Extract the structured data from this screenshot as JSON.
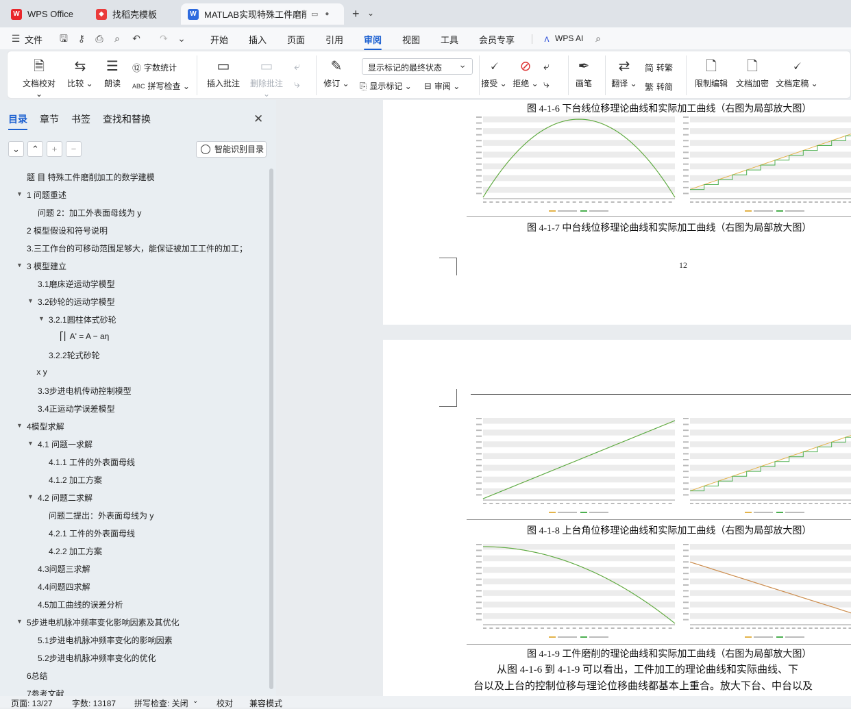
{
  "tabs": [
    {
      "label": "WPS Office",
      "icon": "wps-logo-icon"
    },
    {
      "label": "找稻壳模板",
      "icon": "docer-icon"
    },
    {
      "label": "MATLAB实现特殊工件磨削加",
      "icon": "word-doc-icon"
    }
  ],
  "menu": {
    "file": "文件",
    "items": [
      "开始",
      "插入",
      "页面",
      "引用",
      "审阅",
      "视图",
      "工具",
      "会员专享"
    ],
    "active": "审阅",
    "wps_ai": "WPS AI"
  },
  "ribbon": {
    "proofread": "文档校对",
    "compare": "比较",
    "read_aloud": "朗读",
    "word_count": "字数统计",
    "spell_check": "拼写检查",
    "insert_comment": "插入批注",
    "delete_comment": "删除批注",
    "revise": "修订",
    "markup_state": "显示标记的最终状态",
    "show_markup": "显示标记",
    "review": "审阅",
    "accept": "接受",
    "reject": "拒绝",
    "pen": "画笔",
    "translate": "翻译",
    "to_traditional": "转繁",
    "to_simplified": "转简",
    "restrict_edit": "限制编辑",
    "encrypt": "文档加密",
    "finalize": "文档定稿"
  },
  "sidebar": {
    "tabs": [
      "目录",
      "章节",
      "书签",
      "查找和替换"
    ],
    "smart_toc": "智能识别目录",
    "toc": [
      {
        "text": "题 目  特殊工件磨削加工的数学建模",
        "level": 0,
        "arrow": ""
      },
      {
        "text": "1 问题重述",
        "level": 0,
        "arrow": "▼"
      },
      {
        "text": "问题 2：加工外表面母线为 y",
        "level": 1,
        "arrow": ""
      },
      {
        "text": "2 模型假设和符号说明",
        "level": 0,
        "arrow": ""
      },
      {
        "text": "3.三工作台的可移动范围足够大，能保证被加工工件的加工；",
        "level": 0,
        "arrow": ""
      },
      {
        "text": "3 模型建立",
        "level": 0,
        "arrow": "▼"
      },
      {
        "text": "3.1磨床逆运动学模型",
        "level": 1,
        "arrow": ""
      },
      {
        "text": "3.2砂轮的运动学模型",
        "level": 1,
        "arrow": "▼"
      },
      {
        "text": "3.2.1圆柱体式砂轮",
        "level": 2,
        "arrow": "▼"
      },
      {
        "text": "⎡⎢ A' = A  − aη",
        "level": 3,
        "arrow": ""
      },
      {
        "text": "3.2.2轮式砂轮",
        "level": 2,
        "arrow": ""
      },
      {
        "text": "x y",
        "level": 0.9,
        "arrow": ""
      },
      {
        "text": "3.3步进电机传动控制模型",
        "level": 1,
        "arrow": ""
      },
      {
        "text": "3.4正运动学误差模型",
        "level": 1,
        "arrow": ""
      },
      {
        "text": "4模型求解",
        "level": 0,
        "arrow": "▼"
      },
      {
        "text": "4.1 问题一求解",
        "level": 1,
        "arrow": "▼"
      },
      {
        "text": "4.1.1 工件的外表面母线",
        "level": 2,
        "arrow": ""
      },
      {
        "text": "4.1.2 加工方案",
        "level": 2,
        "arrow": ""
      },
      {
        "text": "4.2 问题二求解",
        "level": 1,
        "arrow": "▼"
      },
      {
        "text": "问题二提出：外表面母线为 y",
        "level": 2,
        "arrow": ""
      },
      {
        "text": "4.2.1 工件的外表面母线",
        "level": 2,
        "arrow": ""
      },
      {
        "text": "4.2.2 加工方案",
        "level": 2,
        "arrow": ""
      },
      {
        "text": "4.3问题三求解",
        "level": 1,
        "arrow": ""
      },
      {
        "text": "4.4问题四求解",
        "level": 1,
        "arrow": ""
      },
      {
        "text": "4.5加工曲线的误差分析",
        "level": 1,
        "arrow": ""
      },
      {
        "text": "5步进电机脉冲频率变化影响因素及其优化",
        "level": 0,
        "arrow": "▼"
      },
      {
        "text": "5.1步进电机脉冲频率变化的影响因素",
        "level": 1,
        "arrow": ""
      },
      {
        "text": "5.2步进电机脉冲频率变化的优化",
        "level": 1,
        "arrow": ""
      },
      {
        "text": "6总结",
        "level": 0,
        "arrow": ""
      },
      {
        "text": "7参考文献",
        "level": 0,
        "arrow": ""
      }
    ]
  },
  "document": {
    "captions": [
      "图 4-1-6 下台线位移理论曲线和实际加工曲线（右图为局部放大图）",
      "图 4-1-7 中台线位移理论曲线和实际加工曲线（右图为局部放大图）",
      "图 4-1-8 上台角位移理论曲线和实际加工曲线（右图为局部放大图）",
      "图 4-1-9 工件磨削的理论曲线和实际加工曲线（右图为局部放大图）"
    ],
    "page_number": "12",
    "paragraph": [
      "从图 4-1-6 到 4-1-9 可以看出，工件加工的理论曲线和实际曲线、下",
      "台以及上台的控制位移与理论位移曲线都基本上重合。放大下台、中台以及"
    ],
    "colors": {
      "theory": "#e3b34a",
      "actual": "#4caf50",
      "band": "#ececec"
    }
  },
  "status": {
    "page": "页面: 13/27",
    "words": "字数: 13187",
    "spell": "拼写检查: 关闭",
    "proof": "校对",
    "compat": "兼容模式"
  }
}
